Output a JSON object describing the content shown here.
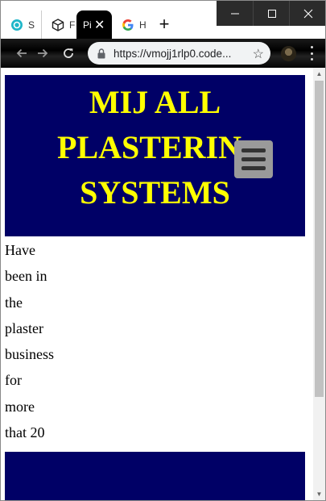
{
  "browser": {
    "tabs": [
      {
        "title": "S",
        "icon": "codepen-circle-icon",
        "active": false
      },
      {
        "title": "F",
        "icon": "codesandbox-box-icon",
        "active": false
      },
      {
        "title": "Pi",
        "icon": "page-icon",
        "active": true
      },
      {
        "title": "H",
        "icon": "google-g-icon",
        "active": false
      }
    ],
    "new_tab_label": "+",
    "close_tab_label": "✕",
    "url": "https://vmojj1rlp0.code...",
    "window_controls": {
      "minimize": "─",
      "maximize": "☐",
      "close": "✕"
    }
  },
  "site": {
    "title_lines": [
      "MIJ ALL",
      "PLASTERIN",
      "SYSTEMS"
    ],
    "intro_lines": [
      "Have",
      "been in",
      "the",
      "plaster",
      "business",
      "for",
      "more",
      "that 20"
    ],
    "colors": {
      "header_bg": "#000066",
      "title": "#ffff00",
      "menu_button": "#9a9a9a"
    }
  }
}
